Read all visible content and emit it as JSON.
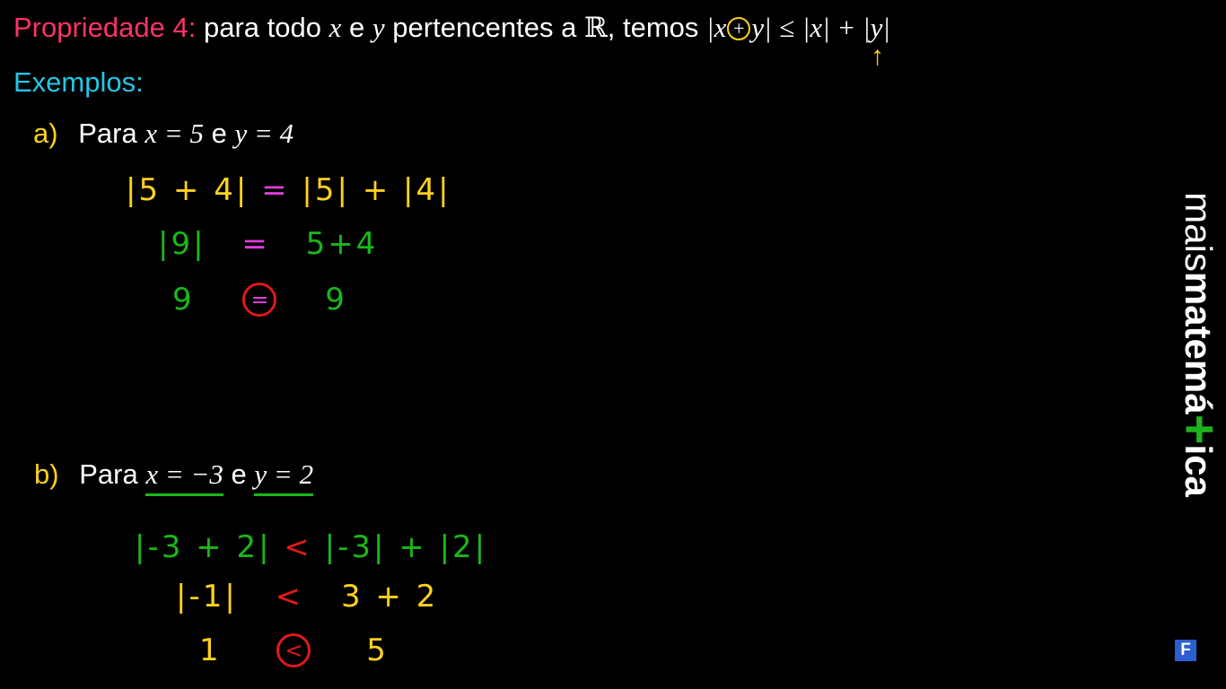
{
  "header": {
    "property_label": "Propriedade 4:",
    "text_1": "para todo",
    "var_x": "x",
    "text_e": "e",
    "var_y": "y",
    "text_2": "pertencentes a",
    "reals": "ℝ",
    "text_3": ", temos",
    "abs_open": "|",
    "plus": "+",
    "abs_close": "|",
    "leq": "≤",
    "rhs": "|x| + |y|",
    "arrow": "↑"
  },
  "examples_label": "Exemplos:",
  "example_a": {
    "label": "a)",
    "text": "Para",
    "cond": "x = 5",
    "e": "e",
    "cond2": "y = 4",
    "step1_lhs": "|5 + 4|",
    "step1_op": "=",
    "step1_rhs": "|5| + |4|",
    "step2_lhs": "|9|",
    "step2_op": "=",
    "step2_rhs": "5+4",
    "step3_lhs": "9",
    "step3_op": "=",
    "step3_rhs": "9"
  },
  "example_b": {
    "label": "b)",
    "text": "Para",
    "cond": "x = −3",
    "e": "e",
    "cond2": "y = 2",
    "step1_lhs": "|-3 + 2|",
    "step1_op": "<",
    "step1_rhs": "|-3| + |2|",
    "step2_lhs": "|-1|",
    "step2_op": "<",
    "step2_rhs": "3 + 2",
    "step3_lhs": "1",
    "step3_op": "<",
    "step3_rhs": "5"
  },
  "logo": {
    "part1": "mais",
    "part2": "matemá",
    "plus": "+",
    "part3": "ica"
  },
  "badge": "F",
  "colors": {
    "property_label": "#ff3366",
    "examples_label": "#22c7e6",
    "item_labels": "#ffd21c",
    "green": "#19b81a",
    "magenta": "#e23bdc",
    "red": "#e01a1a",
    "logo_plus": "#1fb21f",
    "badge": "#2b5fcf"
  }
}
